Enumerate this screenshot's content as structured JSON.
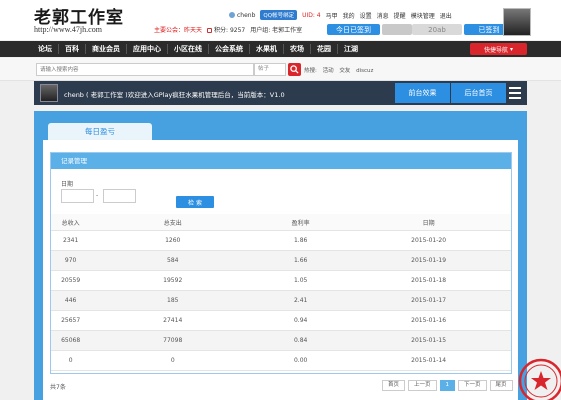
{
  "header": {
    "logo_main": "老郭工作室",
    "logo_url": "http://www.47jh.com",
    "username": "chenb",
    "qq_bind": "QQ帐号绑定",
    "uid": "UID: 4",
    "menu_items": [
      "马甲",
      "我的",
      "设置",
      "消息",
      "提醒",
      "模块管理",
      "退出"
    ],
    "notice": "主要公会：昨天天",
    "points": "积分: 9257",
    "group": "用户组: 老郭工作室",
    "signin_label": "今日已签到",
    "gray_label": "",
    "gray_label2": "20ab",
    "signed_label": "已签到"
  },
  "nav": {
    "items": [
      "论坛",
      "百科",
      "商业会员",
      "应用中心",
      "小区在线",
      "公会系统",
      "水果机",
      "农场",
      "花园",
      "江湖"
    ],
    "quick_nav": "快捷导航"
  },
  "search": {
    "placeholder": "请输入搜索内容",
    "scope": "帖子",
    "hot_label": "热搜:",
    "hot_terms": [
      "活动",
      "交友",
      "discuz"
    ]
  },
  "admin": {
    "welcome": "chenb ( 老郭工作室 )欢迎进入GPlay疯狂水果机管理后台，当前版本：V1.0",
    "front_btn": "前台效果",
    "home_btn": "后台首页"
  },
  "main": {
    "tab_label": "每日盈亏",
    "card_title": "记录管理",
    "date_label": "日期",
    "date_sep": "-",
    "query_btn": "检 索",
    "columns": [
      "总收入",
      "总支出",
      "盈利率",
      "日期"
    ],
    "rows": [
      [
        "2341",
        "1260",
        "1.86",
        "2015-01-20"
      ],
      [
        "970",
        "584",
        "1.66",
        "2015-01-19"
      ],
      [
        "20559",
        "19592",
        "1.05",
        "2015-01-18"
      ],
      [
        "446",
        "185",
        "2.41",
        "2015-01-17"
      ],
      [
        "25657",
        "27414",
        "0.94",
        "2015-01-16"
      ],
      [
        "65068",
        "77098",
        "0.84",
        "2015-01-15"
      ],
      [
        "0",
        "0",
        "0.00",
        "2015-01-14"
      ]
    ],
    "total": "共7条",
    "pager": [
      "首页",
      "上一页",
      "1",
      "下一页",
      "尾页"
    ],
    "current_page": "1"
  },
  "colors": {
    "accent": "#2d8fe2",
    "nav_bg": "#2b2b2b",
    "brand_red": "#d9262c",
    "content_bg": "#47a0e0"
  }
}
